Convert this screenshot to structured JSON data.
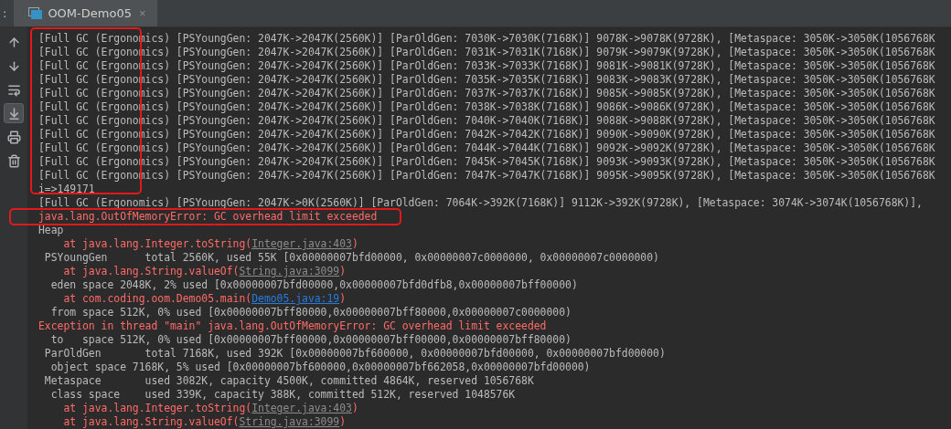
{
  "tab_bar": {
    "prefix": ":",
    "tabs": [
      {
        "label": "OOM-Demo05",
        "close": "×",
        "selected": true
      }
    ]
  },
  "toolbar": [
    {
      "kind": "up",
      "selected": false
    },
    {
      "kind": "down",
      "selected": false
    },
    {
      "kind": "wrap",
      "selected": false
    },
    {
      "kind": "scroll-end",
      "selected": true
    },
    {
      "kind": "print",
      "selected": false
    },
    {
      "kind": "clear",
      "selected": false
    }
  ],
  "console": {
    "groups": [
      {
        "outlined": true,
        "lines": [
          {
            "kind": "out",
            "text": "[Full GC (Ergonomics) [PSYoungGen: 2047K->2047K(2560K)] [ParOldGen: 7030K->7030K(7168K)] 9078K->9078K(9728K), [Metaspace: 3050K->3050K(1056768K"
          },
          {
            "kind": "out",
            "text": "[Full GC (Ergonomics) [PSYoungGen: 2047K->2047K(2560K)] [ParOldGen: 7031K->7031K(7168K)] 9079K->9079K(9728K), [Metaspace: 3050K->3050K(1056768K"
          },
          {
            "kind": "out",
            "text": "[Full GC (Ergonomics) [PSYoungGen: 2047K->2047K(2560K)] [ParOldGen: 7033K->7033K(7168K)] 9081K->9081K(9728K), [Metaspace: 3050K->3050K(1056768K"
          },
          {
            "kind": "out",
            "text": "[Full GC (Ergonomics) [PSYoungGen: 2047K->2047K(2560K)] [ParOldGen: 7035K->7035K(7168K)] 9083K->9083K(9728K), [Metaspace: 3050K->3050K(1056768K"
          },
          {
            "kind": "out",
            "text": "[Full GC (Ergonomics) [PSYoungGen: 2047K->2047K(2560K)] [ParOldGen: 7037K->7037K(7168K)] 9085K->9085K(9728K), [Metaspace: 3050K->3050K(1056768K"
          },
          {
            "kind": "out",
            "text": "[Full GC (Ergonomics) [PSYoungGen: 2047K->2047K(2560K)] [ParOldGen: 7038K->7038K(7168K)] 9086K->9086K(9728K), [Metaspace: 3050K->3050K(1056768K"
          },
          {
            "kind": "out",
            "text": "[Full GC (Ergonomics) [PSYoungGen: 2047K->2047K(2560K)] [ParOldGen: 7040K->7040K(7168K)] 9088K->9088K(9728K), [Metaspace: 3050K->3050K(1056768K"
          },
          {
            "kind": "out",
            "text": "[Full GC (Ergonomics) [PSYoungGen: 2047K->2047K(2560K)] [ParOldGen: 7042K->7042K(7168K)] 9090K->9090K(9728K), [Metaspace: 3050K->3050K(1056768K"
          },
          {
            "kind": "out",
            "text": "[Full GC (Ergonomics) [PSYoungGen: 2047K->2047K(2560K)] [ParOldGen: 7044K->7044K(7168K)] 9092K->9092K(9728K), [Metaspace: 3050K->3050K(1056768K"
          },
          {
            "kind": "out",
            "text": "[Full GC (Ergonomics) [PSYoungGen: 2047K->2047K(2560K)] [ParOldGen: 7045K->7045K(7168K)] 9093K->9093K(9728K), [Metaspace: 3050K->3050K(1056768K"
          },
          {
            "kind": "out",
            "text": "[Full GC (Ergonomics) [PSYoungGen: 2047K->2047K(2560K)] [ParOldGen: 7047K->7047K(7168K)] 9095K->9095K(9728K), [Metaspace: 3050K->3050K(1056768K"
          },
          {
            "kind": "out",
            "text": "i=>149171"
          }
        ]
      },
      {
        "outlined": false,
        "lines": [
          {
            "kind": "out",
            "text": "[Full GC (Ergonomics) [PSYoungGen: 2047K->0K(2560K)] [ParOldGen: 7064K->392K(7168K)] 9112K->392K(9728K), [Metaspace: 3074K->3074K(1056768K)],"
          }
        ]
      },
      {
        "outlined": true,
        "lines": [
          {
            "kind": "err",
            "text": "java.lang.OutOfMemoryError: GC overhead limit exceeded"
          }
        ]
      },
      {
        "outlined": false,
        "lines": [
          {
            "kind": "out",
            "text": "Heap"
          },
          {
            "kind": "trace",
            "text": "    at java.lang.Integer.toString(",
            "link": "Integer.java:403",
            "project_file": false,
            "tail": ")"
          },
          {
            "kind": "out",
            "text": " PSYoungGen      total 2560K, used 55K [0x00000007bfd00000, 0x00000007c0000000, 0x00000007c0000000)"
          },
          {
            "kind": "trace",
            "text": "    at java.lang.String.valueOf(",
            "link": "String.java:3099",
            "project_file": false,
            "tail": ")"
          },
          {
            "kind": "out",
            "text": "  eden space 2048K, 2% used [0x00000007bfd00000,0x00000007bfd0dfb8,0x00000007bff00000)"
          },
          {
            "kind": "trace",
            "text": "    at com.coding.oom.Demo05.main(",
            "link": "Demo05.java:19",
            "project_file": true,
            "tail": ")"
          },
          {
            "kind": "out",
            "text": "  from space 512K, 0% used [0x00000007bff80000,0x00000007bff80000,0x00000007c0000000)"
          },
          {
            "kind": "err",
            "text": "Exception in thread \"main\" java.lang.OutOfMemoryError: GC overhead limit exceeded"
          },
          {
            "kind": "out",
            "text": "  to   space 512K, 0% used [0x00000007bff00000,0x00000007bff00000,0x00000007bff80000)"
          },
          {
            "kind": "out",
            "text": " ParOldGen       total 7168K, used 392K [0x00000007bf600000, 0x00000007bfd00000, 0x00000007bfd00000)"
          },
          {
            "kind": "out",
            "text": "  object space 7168K, 5% used [0x00000007bf600000,0x00000007bf662058,0x00000007bfd00000)"
          },
          {
            "kind": "out",
            "text": " Metaspace       used 3082K, capacity 4500K, committed 4864K, reserved 1056768K"
          },
          {
            "kind": "out",
            "text": "  class space    used 339K, capacity 388K, committed 512K, reserved 1048576K"
          },
          {
            "kind": "trace",
            "text": "    at java.lang.Integer.toString(",
            "link": "Integer.java:403",
            "project_file": false,
            "tail": ")"
          },
          {
            "kind": "trace",
            "text": "    at java.lang.String.valueOf(",
            "link": "String.java:3099",
            "project_file": false,
            "tail": ")"
          }
        ]
      }
    ]
  }
}
